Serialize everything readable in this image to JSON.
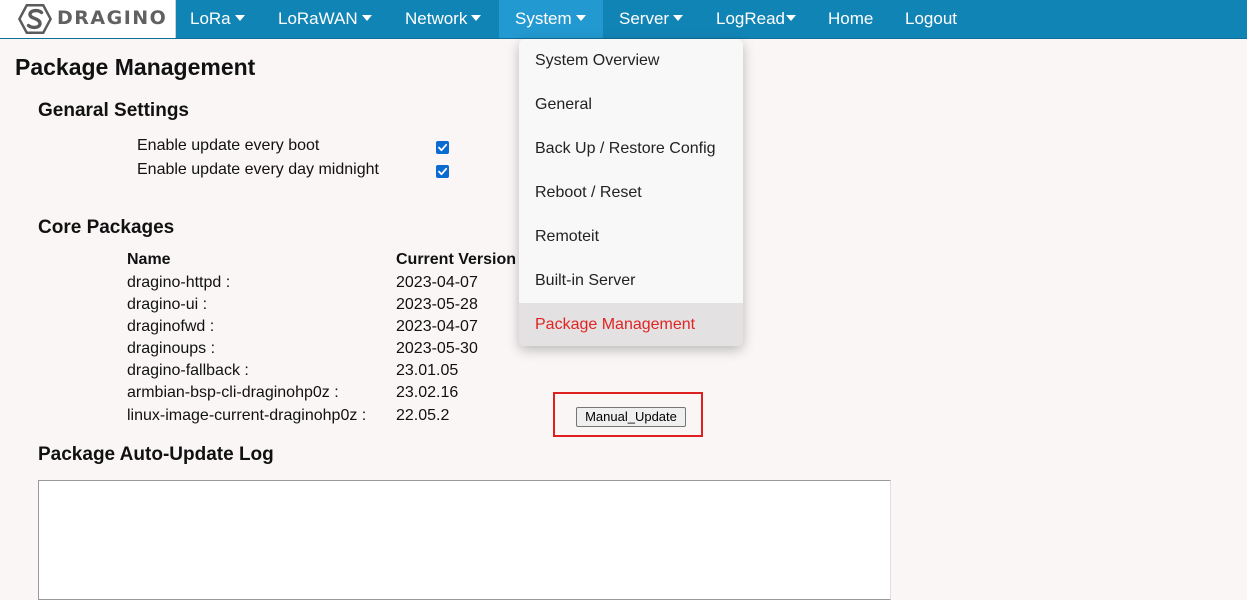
{
  "brand": {
    "logo_text": "DRAGINO",
    "logo_icon": "dragino-s-logo-icon"
  },
  "nav": {
    "items": [
      {
        "label": "LoRa",
        "dropdown": true
      },
      {
        "label": "LoRaWAN",
        "dropdown": true
      },
      {
        "label": "Network",
        "dropdown": true
      },
      {
        "label": "System",
        "dropdown": true,
        "active": true
      },
      {
        "label": "Server",
        "dropdown": true
      },
      {
        "label": "LogRead",
        "dropdown": true
      },
      {
        "label": "Home",
        "dropdown": false
      },
      {
        "label": "Logout",
        "dropdown": false
      }
    ]
  },
  "page": {
    "title": "Package Management"
  },
  "general": {
    "title": "Genaral Settings",
    "settings": [
      {
        "label": "Enable update every boot",
        "checked": true
      },
      {
        "label": "Enable update every day midnight",
        "checked": true
      }
    ]
  },
  "core": {
    "title": "Core Packages",
    "headers": {
      "name": "Name",
      "version": "Current Version"
    },
    "packages": [
      {
        "name": "dragino-httpd :",
        "version": "2023-04-07"
      },
      {
        "name": "dragino-ui :",
        "version": "2023-05-28"
      },
      {
        "name": "draginofwd :",
        "version": "2023-04-07"
      },
      {
        "name": "draginoups :",
        "version": "2023-05-30"
      },
      {
        "name": "dragino-fallback :",
        "version": "23.01.05"
      },
      {
        "name": "armbian-bsp-cli-draginohp0z :",
        "version": "23.02.16"
      },
      {
        "name": "linux-image-current-draginohp0z :",
        "version": "22.05.2"
      }
    ],
    "manual_update_label": "Manual_Update"
  },
  "log": {
    "title": "Package Auto-Update Log",
    "content": ""
  },
  "system_menu": {
    "items": [
      {
        "label": "System Overview"
      },
      {
        "label": "General"
      },
      {
        "label": "Back Up / Restore Config"
      },
      {
        "label": "Reboot / Reset"
      },
      {
        "label": "Remoteit"
      },
      {
        "label": "Built-in Server"
      },
      {
        "label": "Package Management",
        "selected": true
      }
    ]
  },
  "colors": {
    "navbar": "#1184b6",
    "nav_active": "#2299d0",
    "selected_menu_text": "#e02424",
    "highlight_frame": "#e02020",
    "checkbox": "#0a6bd1"
  }
}
